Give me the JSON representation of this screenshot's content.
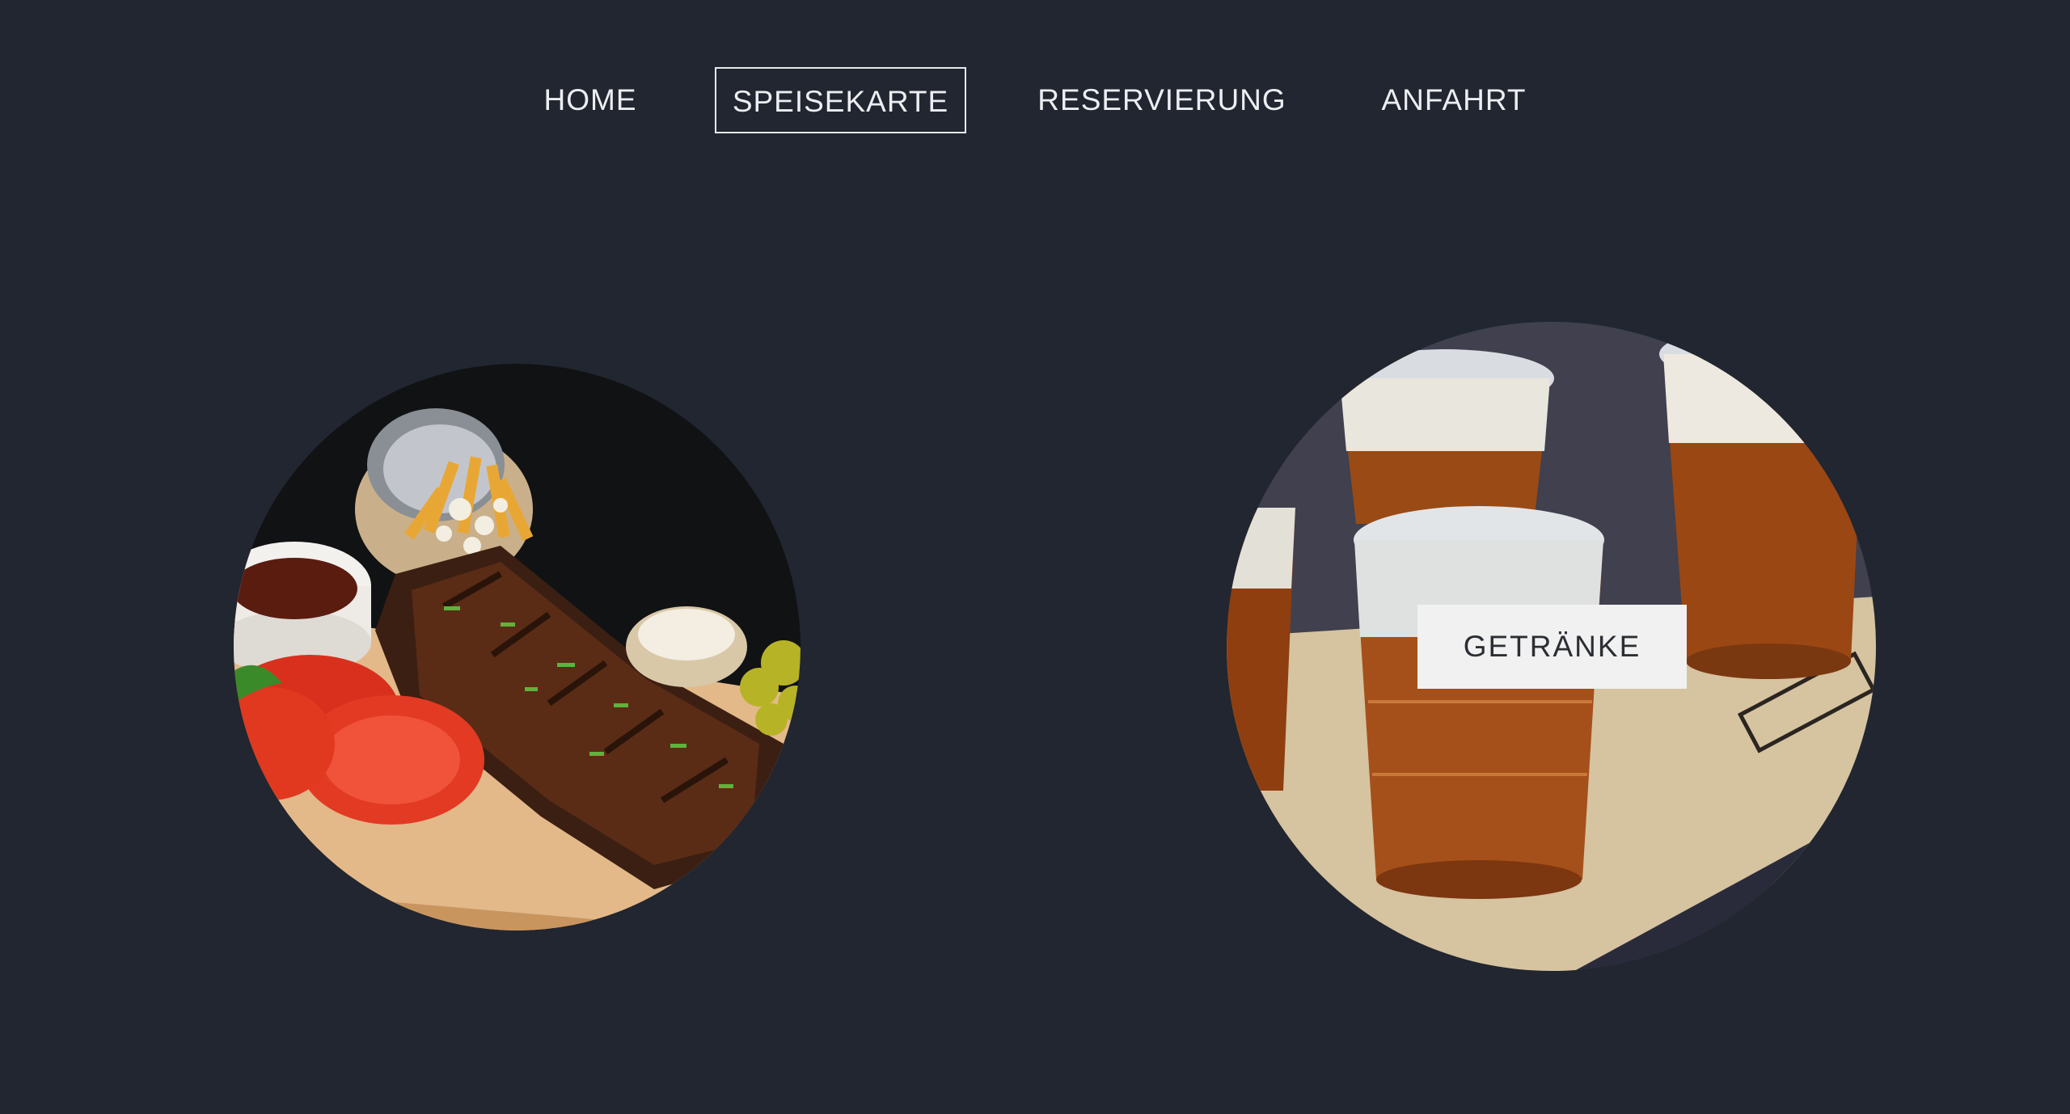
{
  "nav": {
    "items": [
      {
        "label": "HOME"
      },
      {
        "label": "SPEISEKARTE",
        "active": true
      },
      {
        "label": "RESERVIERUNG"
      },
      {
        "label": "ANFAHRT"
      }
    ]
  },
  "sections": {
    "food": {
      "image": "food-photo-ribs-fries"
    },
    "drinks": {
      "image": "beer-cups-photo",
      "button_label": "GETRÄNKE"
    }
  },
  "colors": {
    "background": "#212630",
    "nav_text": "#eceef2",
    "button_bg": "#f1f1f2",
    "button_text": "#2b2e33"
  }
}
